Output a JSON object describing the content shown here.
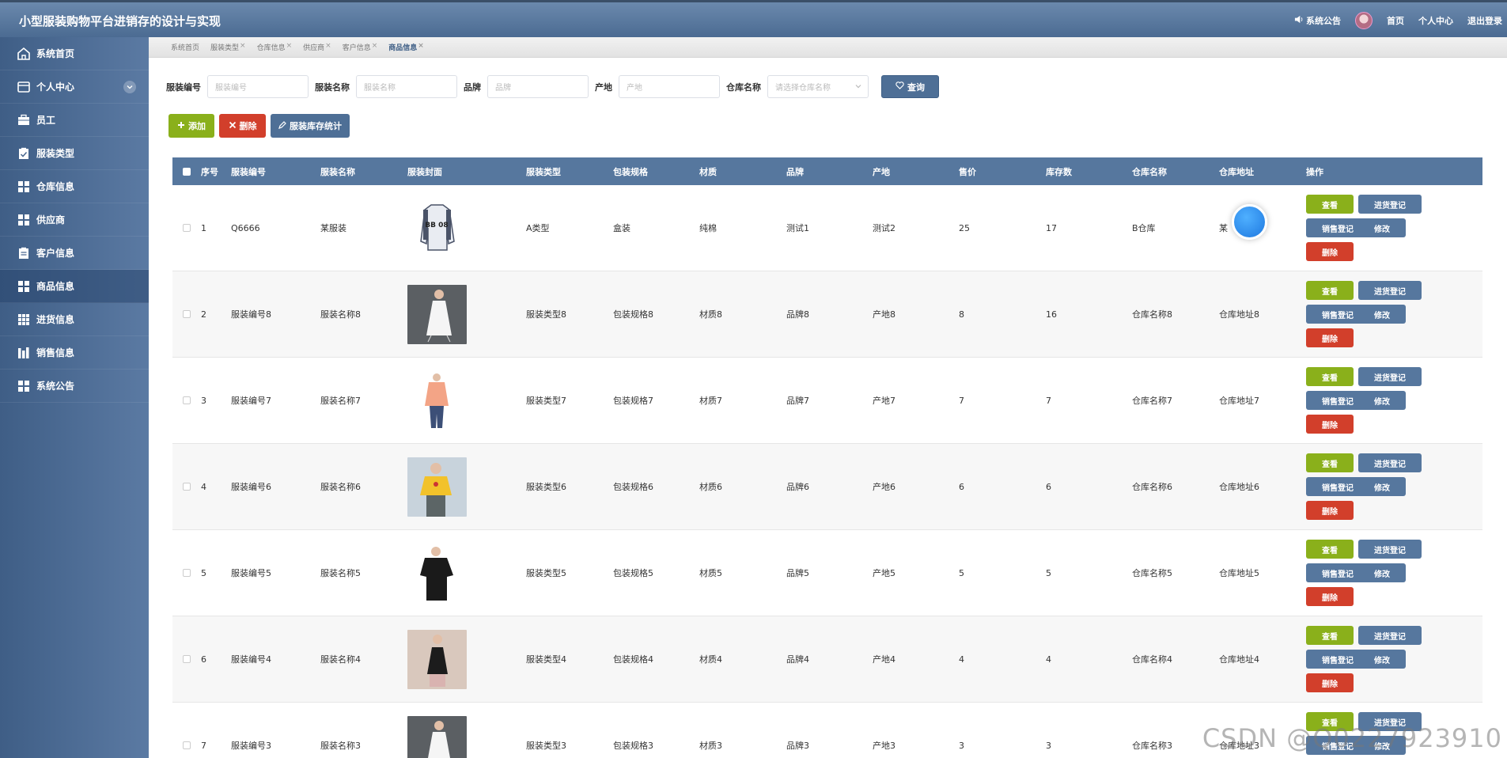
{
  "app": {
    "title": "小型服装购物平台进销存的设计与实现"
  },
  "topnav": {
    "announce": "系统公告",
    "home": "首页",
    "profile": "个人中心",
    "logout": "退出登录"
  },
  "sidebar": {
    "items": [
      {
        "label": "系统首页",
        "icon": "home-icon"
      },
      {
        "label": "个人中心",
        "icon": "wallet-icon"
      },
      {
        "label": "员工",
        "icon": "briefcase-icon"
      },
      {
        "label": "服装类型",
        "icon": "clipboard-check-icon"
      },
      {
        "label": "仓库信息",
        "icon": "grid-icon"
      },
      {
        "label": "供应商",
        "icon": "grid-icon"
      },
      {
        "label": "客户信息",
        "icon": "clipboard-icon"
      },
      {
        "label": "商品信息",
        "icon": "grid-icon"
      },
      {
        "label": "进货信息",
        "icon": "grid-9-icon"
      },
      {
        "label": "销售信息",
        "icon": "bars-icon"
      },
      {
        "label": "系统公告",
        "icon": "grid-icon"
      }
    ]
  },
  "tabs": [
    {
      "label": "系统首页",
      "closable": false
    },
    {
      "label": "服装类型",
      "closable": true
    },
    {
      "label": "仓库信息",
      "closable": true
    },
    {
      "label": "供应商",
      "closable": true
    },
    {
      "label": "客户信息",
      "closable": true
    },
    {
      "label": "商品信息",
      "closable": true
    }
  ],
  "search": {
    "code_label": "服装编号",
    "code_placeholder": "服装编号",
    "name_label": "服装名称",
    "name_placeholder": "服装名称",
    "brand_label": "品牌",
    "brand_placeholder": "品牌",
    "origin_label": "产地",
    "origin_placeholder": "产地",
    "warehouse_label": "仓库名称",
    "warehouse_placeholder": "请选择仓库名称",
    "query_label": "查询"
  },
  "actions": {
    "add": "添加",
    "delete": "删除",
    "stats": "服装库存统计"
  },
  "table": {
    "headers": {
      "idx": "序号",
      "code": "服装编号",
      "name": "服装名称",
      "cover": "服装封面",
      "type": "服装类型",
      "pack": "包装规格",
      "material": "材质",
      "brand": "品牌",
      "origin": "产地",
      "price": "售价",
      "stock": "库存数",
      "wname": "仓库名称",
      "waddr": "仓库地址",
      "ops": "操作"
    },
    "op_labels": {
      "view": "查看",
      "inreg": "进货登记",
      "salereg": "销售登记",
      "edit": "修改",
      "remove": "删除"
    },
    "rows": [
      {
        "idx": "1",
        "code": "Q6666",
        "name": "某服装",
        "type": "A类型",
        "pack": "盒装",
        "material": "纯棉",
        "brand": "测试1",
        "origin": "测试2",
        "price": "25",
        "stock": "17",
        "wname": "B仓库",
        "waddr": "某",
        "img": "jacket"
      },
      {
        "idx": "2",
        "code": "服装编号8",
        "name": "服装名称8",
        "type": "服装类型8",
        "pack": "包装规格8",
        "material": "材质8",
        "brand": "品牌8",
        "origin": "产地8",
        "price": "8",
        "stock": "16",
        "wname": "仓库名称8",
        "waddr": "仓库地址8",
        "img": "white-dress"
      },
      {
        "idx": "3",
        "code": "服装编号7",
        "name": "服装名称7",
        "type": "服装类型7",
        "pack": "包装规格7",
        "material": "材质7",
        "brand": "品牌7",
        "origin": "产地7",
        "price": "7",
        "stock": "7",
        "wname": "仓库名称7",
        "waddr": "仓库地址7",
        "img": "orange-top"
      },
      {
        "idx": "4",
        "code": "服装编号6",
        "name": "服装名称6",
        "type": "服装类型6",
        "pack": "包装规格6",
        "material": "材质6",
        "brand": "品牌6",
        "origin": "产地6",
        "price": "6",
        "stock": "6",
        "wname": "仓库名称6",
        "waddr": "仓库地址6",
        "img": "yellow-shirt"
      },
      {
        "idx": "5",
        "code": "服装编号5",
        "name": "服装名称5",
        "type": "服装类型5",
        "pack": "包装规格5",
        "material": "材质5",
        "brand": "品牌5",
        "origin": "产地5",
        "price": "5",
        "stock": "5",
        "wname": "仓库名称5",
        "waddr": "仓库地址5",
        "img": "black-top"
      },
      {
        "idx": "6",
        "code": "服装编号4",
        "name": "服装名称4",
        "type": "服装类型4",
        "pack": "包装规格4",
        "material": "材质4",
        "brand": "品牌4",
        "origin": "产地4",
        "price": "4",
        "stock": "4",
        "wname": "仓库名称4",
        "waddr": "仓库地址4",
        "img": "black-dress"
      },
      {
        "idx": "7",
        "code": "服装编号3",
        "name": "服装名称3",
        "type": "服装类型3",
        "pack": "包装规格3",
        "material": "材质3",
        "brand": "品牌3",
        "origin": "产地3",
        "price": "3",
        "stock": "3",
        "wname": "仓库名称3",
        "waddr": "仓库地址3",
        "img": "white-dress"
      }
    ]
  },
  "watermark": "CSDN @Q0227923910"
}
